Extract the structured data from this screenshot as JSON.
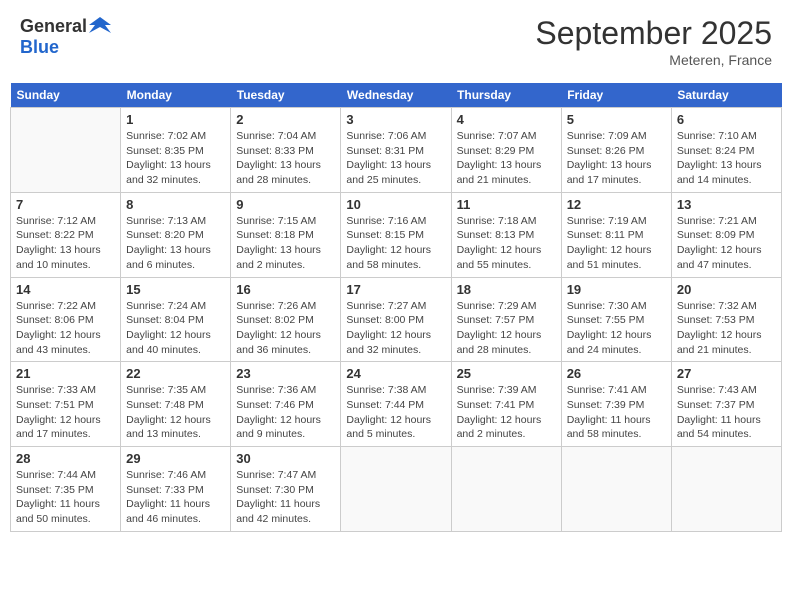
{
  "logo": {
    "general": "General",
    "blue": "Blue"
  },
  "title": "September 2025",
  "location": "Meteren, France",
  "weekdays": [
    "Sunday",
    "Monday",
    "Tuesday",
    "Wednesday",
    "Thursday",
    "Friday",
    "Saturday"
  ],
  "weeks": [
    [
      {
        "day": "",
        "info": ""
      },
      {
        "day": "1",
        "info": "Sunrise: 7:02 AM\nSunset: 8:35 PM\nDaylight: 13 hours\nand 32 minutes."
      },
      {
        "day": "2",
        "info": "Sunrise: 7:04 AM\nSunset: 8:33 PM\nDaylight: 13 hours\nand 28 minutes."
      },
      {
        "day": "3",
        "info": "Sunrise: 7:06 AM\nSunset: 8:31 PM\nDaylight: 13 hours\nand 25 minutes."
      },
      {
        "day": "4",
        "info": "Sunrise: 7:07 AM\nSunset: 8:29 PM\nDaylight: 13 hours\nand 21 minutes."
      },
      {
        "day": "5",
        "info": "Sunrise: 7:09 AM\nSunset: 8:26 PM\nDaylight: 13 hours\nand 17 minutes."
      },
      {
        "day": "6",
        "info": "Sunrise: 7:10 AM\nSunset: 8:24 PM\nDaylight: 13 hours\nand 14 minutes."
      }
    ],
    [
      {
        "day": "7",
        "info": "Sunrise: 7:12 AM\nSunset: 8:22 PM\nDaylight: 13 hours\nand 10 minutes."
      },
      {
        "day": "8",
        "info": "Sunrise: 7:13 AM\nSunset: 8:20 PM\nDaylight: 13 hours\nand 6 minutes."
      },
      {
        "day": "9",
        "info": "Sunrise: 7:15 AM\nSunset: 8:18 PM\nDaylight: 13 hours\nand 2 minutes."
      },
      {
        "day": "10",
        "info": "Sunrise: 7:16 AM\nSunset: 8:15 PM\nDaylight: 12 hours\nand 58 minutes."
      },
      {
        "day": "11",
        "info": "Sunrise: 7:18 AM\nSunset: 8:13 PM\nDaylight: 12 hours\nand 55 minutes."
      },
      {
        "day": "12",
        "info": "Sunrise: 7:19 AM\nSunset: 8:11 PM\nDaylight: 12 hours\nand 51 minutes."
      },
      {
        "day": "13",
        "info": "Sunrise: 7:21 AM\nSunset: 8:09 PM\nDaylight: 12 hours\nand 47 minutes."
      }
    ],
    [
      {
        "day": "14",
        "info": "Sunrise: 7:22 AM\nSunset: 8:06 PM\nDaylight: 12 hours\nand 43 minutes."
      },
      {
        "day": "15",
        "info": "Sunrise: 7:24 AM\nSunset: 8:04 PM\nDaylight: 12 hours\nand 40 minutes."
      },
      {
        "day": "16",
        "info": "Sunrise: 7:26 AM\nSunset: 8:02 PM\nDaylight: 12 hours\nand 36 minutes."
      },
      {
        "day": "17",
        "info": "Sunrise: 7:27 AM\nSunset: 8:00 PM\nDaylight: 12 hours\nand 32 minutes."
      },
      {
        "day": "18",
        "info": "Sunrise: 7:29 AM\nSunset: 7:57 PM\nDaylight: 12 hours\nand 28 minutes."
      },
      {
        "day": "19",
        "info": "Sunrise: 7:30 AM\nSunset: 7:55 PM\nDaylight: 12 hours\nand 24 minutes."
      },
      {
        "day": "20",
        "info": "Sunrise: 7:32 AM\nSunset: 7:53 PM\nDaylight: 12 hours\nand 21 minutes."
      }
    ],
    [
      {
        "day": "21",
        "info": "Sunrise: 7:33 AM\nSunset: 7:51 PM\nDaylight: 12 hours\nand 17 minutes."
      },
      {
        "day": "22",
        "info": "Sunrise: 7:35 AM\nSunset: 7:48 PM\nDaylight: 12 hours\nand 13 minutes."
      },
      {
        "day": "23",
        "info": "Sunrise: 7:36 AM\nSunset: 7:46 PM\nDaylight: 12 hours\nand 9 minutes."
      },
      {
        "day": "24",
        "info": "Sunrise: 7:38 AM\nSunset: 7:44 PM\nDaylight: 12 hours\nand 5 minutes."
      },
      {
        "day": "25",
        "info": "Sunrise: 7:39 AM\nSunset: 7:41 PM\nDaylight: 12 hours\nand 2 minutes."
      },
      {
        "day": "26",
        "info": "Sunrise: 7:41 AM\nSunset: 7:39 PM\nDaylight: 11 hours\nand 58 minutes."
      },
      {
        "day": "27",
        "info": "Sunrise: 7:43 AM\nSunset: 7:37 PM\nDaylight: 11 hours\nand 54 minutes."
      }
    ],
    [
      {
        "day": "28",
        "info": "Sunrise: 7:44 AM\nSunset: 7:35 PM\nDaylight: 11 hours\nand 50 minutes."
      },
      {
        "day": "29",
        "info": "Sunrise: 7:46 AM\nSunset: 7:33 PM\nDaylight: 11 hours\nand 46 minutes."
      },
      {
        "day": "30",
        "info": "Sunrise: 7:47 AM\nSunset: 7:30 PM\nDaylight: 11 hours\nand 42 minutes."
      },
      {
        "day": "",
        "info": ""
      },
      {
        "day": "",
        "info": ""
      },
      {
        "day": "",
        "info": ""
      },
      {
        "day": "",
        "info": ""
      }
    ]
  ]
}
